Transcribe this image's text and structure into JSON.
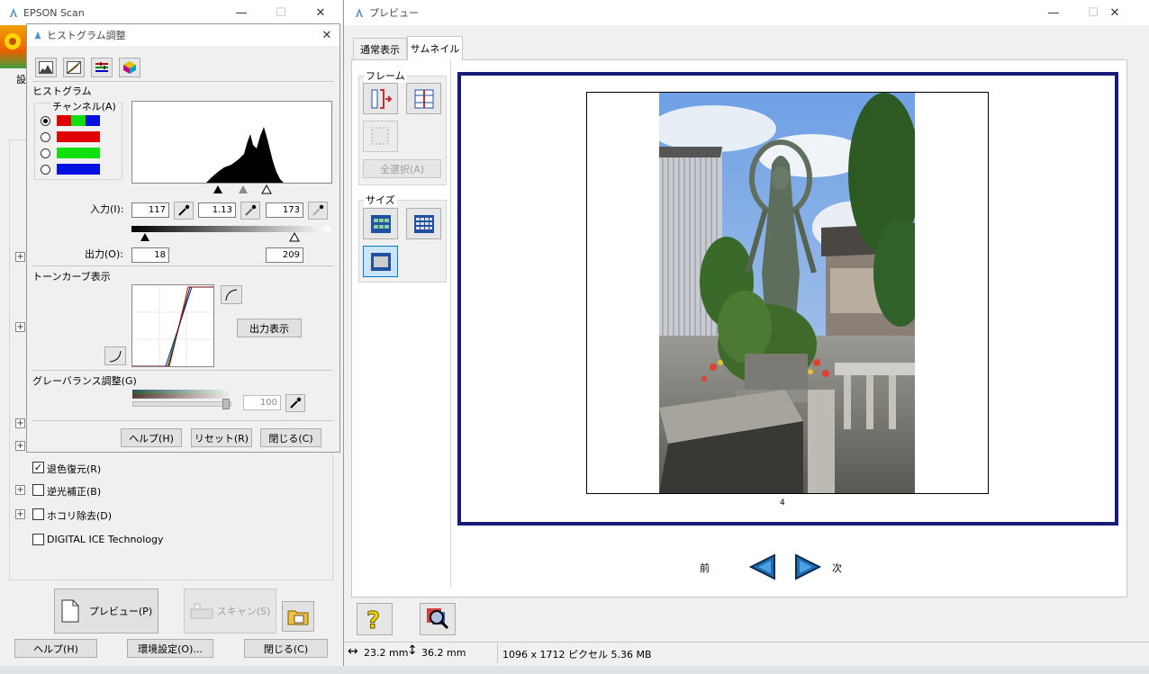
{
  "main_window": {
    "title": "EPSON Scan",
    "settings_fragment": "設",
    "options": [
      {
        "label": "退色復元(R)",
        "checked": true,
        "expandable": false
      },
      {
        "label": "逆光補正(B)",
        "checked": false,
        "expandable": true
      },
      {
        "label": "ホコリ除去(D)",
        "checked": false,
        "expandable": true
      },
      {
        "label": "DIGITAL ICE Technology",
        "checked": false,
        "expandable": false
      }
    ],
    "preview_button": "プレビュー(P)",
    "scan_button": "スキャン(S)",
    "help_button": "ヘルプ(H)",
    "config_button": "環境設定(O)...",
    "close_button": "閉じる(C)"
  },
  "histogram_dialog": {
    "title": "ヒストグラム調整",
    "section_histogram": "ヒストグラム",
    "channel_label": "チャンネル(A)",
    "input_label": "入力(I):",
    "input_values": [
      "117",
      "1.13",
      "173"
    ],
    "output_label": "出力(O):",
    "output_values": [
      "18",
      "209"
    ],
    "section_tone": "トーンカーブ表示",
    "output_display_button": "出力表示",
    "section_gray": "グレーバランス調整(G)",
    "gray_value": "100",
    "help_button": "ヘルプ(H)",
    "reset_button": "リセット(R)",
    "close_button": "閉じる(C)"
  },
  "preview_window": {
    "title": "プレビュー",
    "tabs": [
      {
        "label": "通常表示",
        "active": false
      },
      {
        "label": "サムネイル",
        "active": true
      }
    ],
    "frame_label": "フレーム",
    "select_all_button": "全選択(A)",
    "size_label": "サイズ",
    "frame_number": "4",
    "prev_label": "前",
    "next_label": "次",
    "status_width": "23.2 mm",
    "status_height": "36.2 mm",
    "status_pixels": "1096 x 1712 ピクセル 5.36 MB"
  },
  "colors": {
    "accent_border": "#1a1a7a",
    "red": "#e00000",
    "green": "#10e010",
    "blue": "#0010e0",
    "arrow_blue": "#1e6fb0"
  }
}
